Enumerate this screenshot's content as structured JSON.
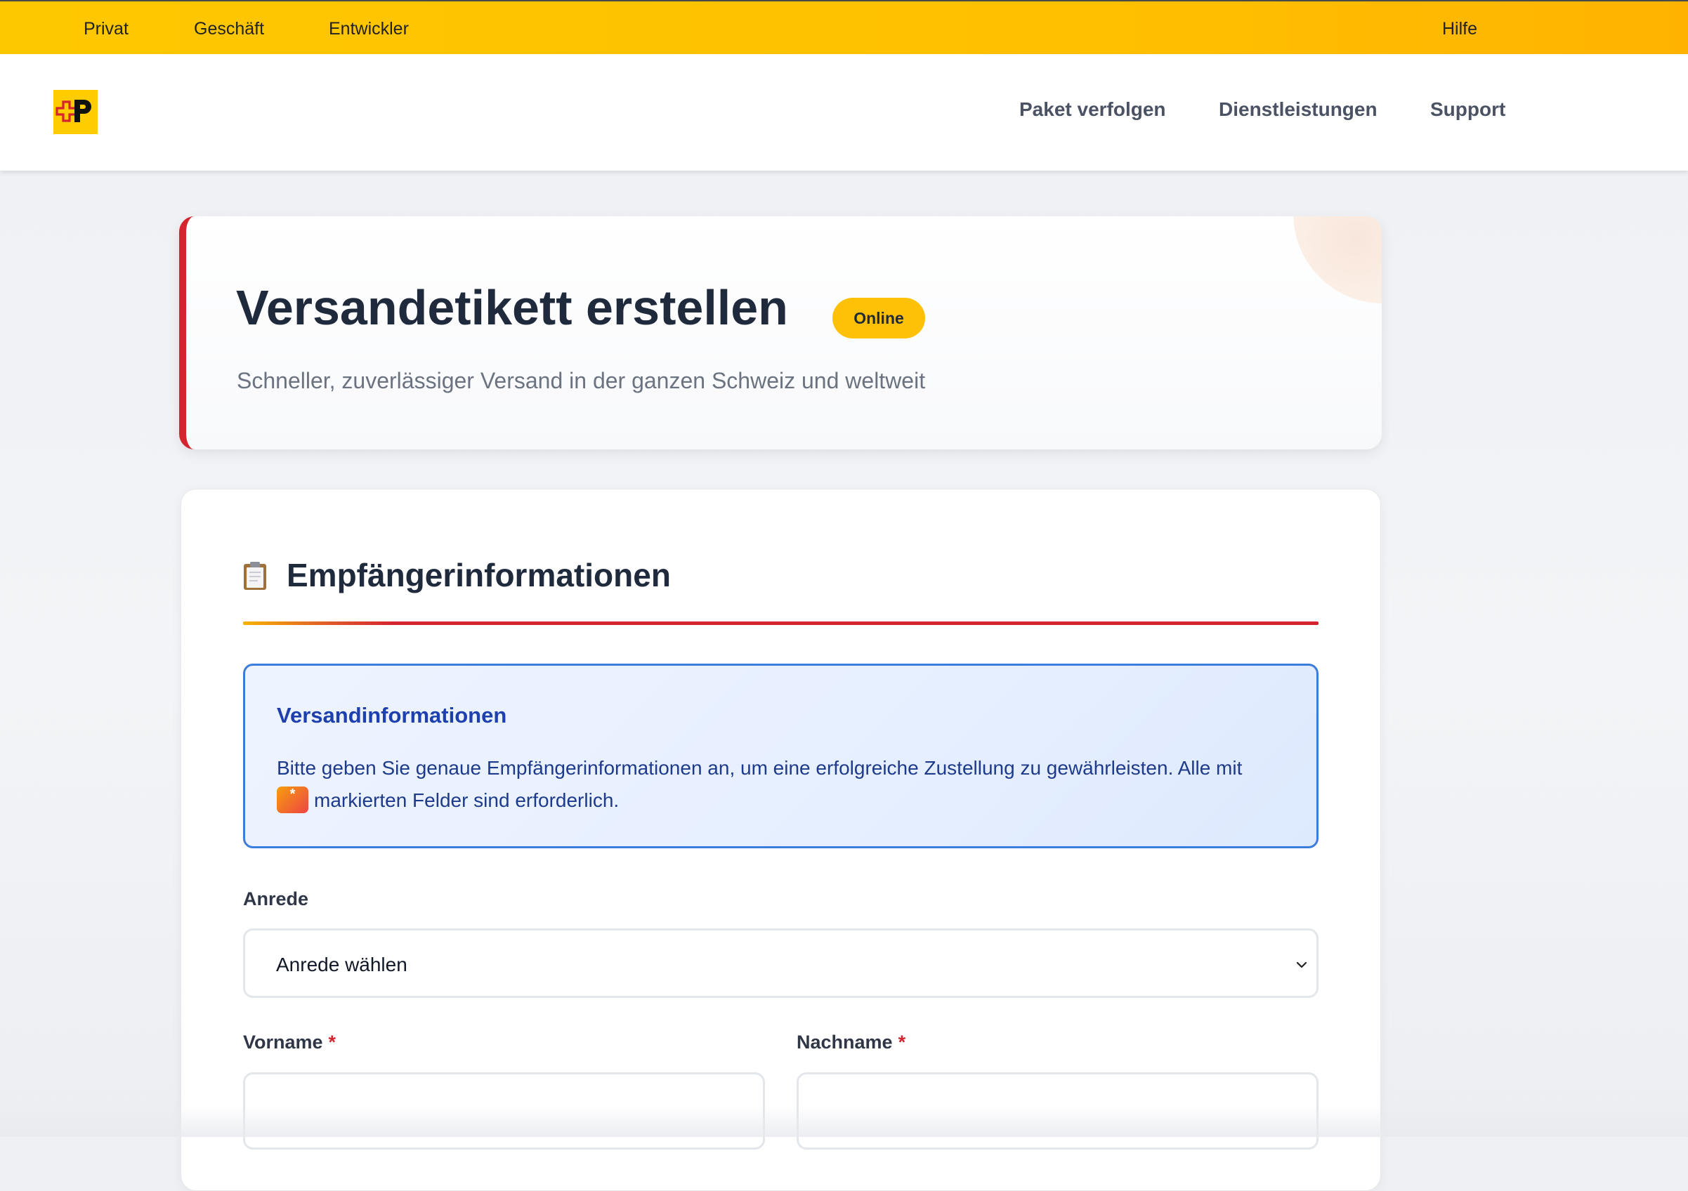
{
  "topbar": {
    "links": [
      "Privat",
      "Geschäft",
      "Entwickler"
    ],
    "help": "Hilfe"
  },
  "header": {
    "logo_alt": "Post Logo",
    "nav": [
      "Paket verfolgen",
      "Dienstleistungen",
      "Support"
    ]
  },
  "hero": {
    "title": "Versandetikett erstellen",
    "badge": "Online",
    "subtitle": "Schneller, zuverlässiger Versand in der ganzen Schweiz und weltweit"
  },
  "form": {
    "section_icon": "clipboard-icon",
    "section_title": "Empfängerinformationen",
    "info": {
      "title": "Versandinformationen",
      "text_before": "Bitte geben Sie genaue Empfängerinformationen an, um eine erfolgreiche Zustellung zu gewährleisten. Alle mit",
      "required_marker": "*",
      "text_after": "markierten Felder sind erforderlich."
    },
    "salutation": {
      "label": "Anrede",
      "value": "Anrede wählen"
    },
    "firstname": {
      "label": "Vorname",
      "required": "*",
      "value": ""
    },
    "lastname": {
      "label": "Nachname",
      "required": "*",
      "value": ""
    }
  },
  "colors": {
    "brand_yellow": "#ffcc00",
    "brand_red": "#d4242f",
    "info_blue": "#3b7ddd"
  }
}
